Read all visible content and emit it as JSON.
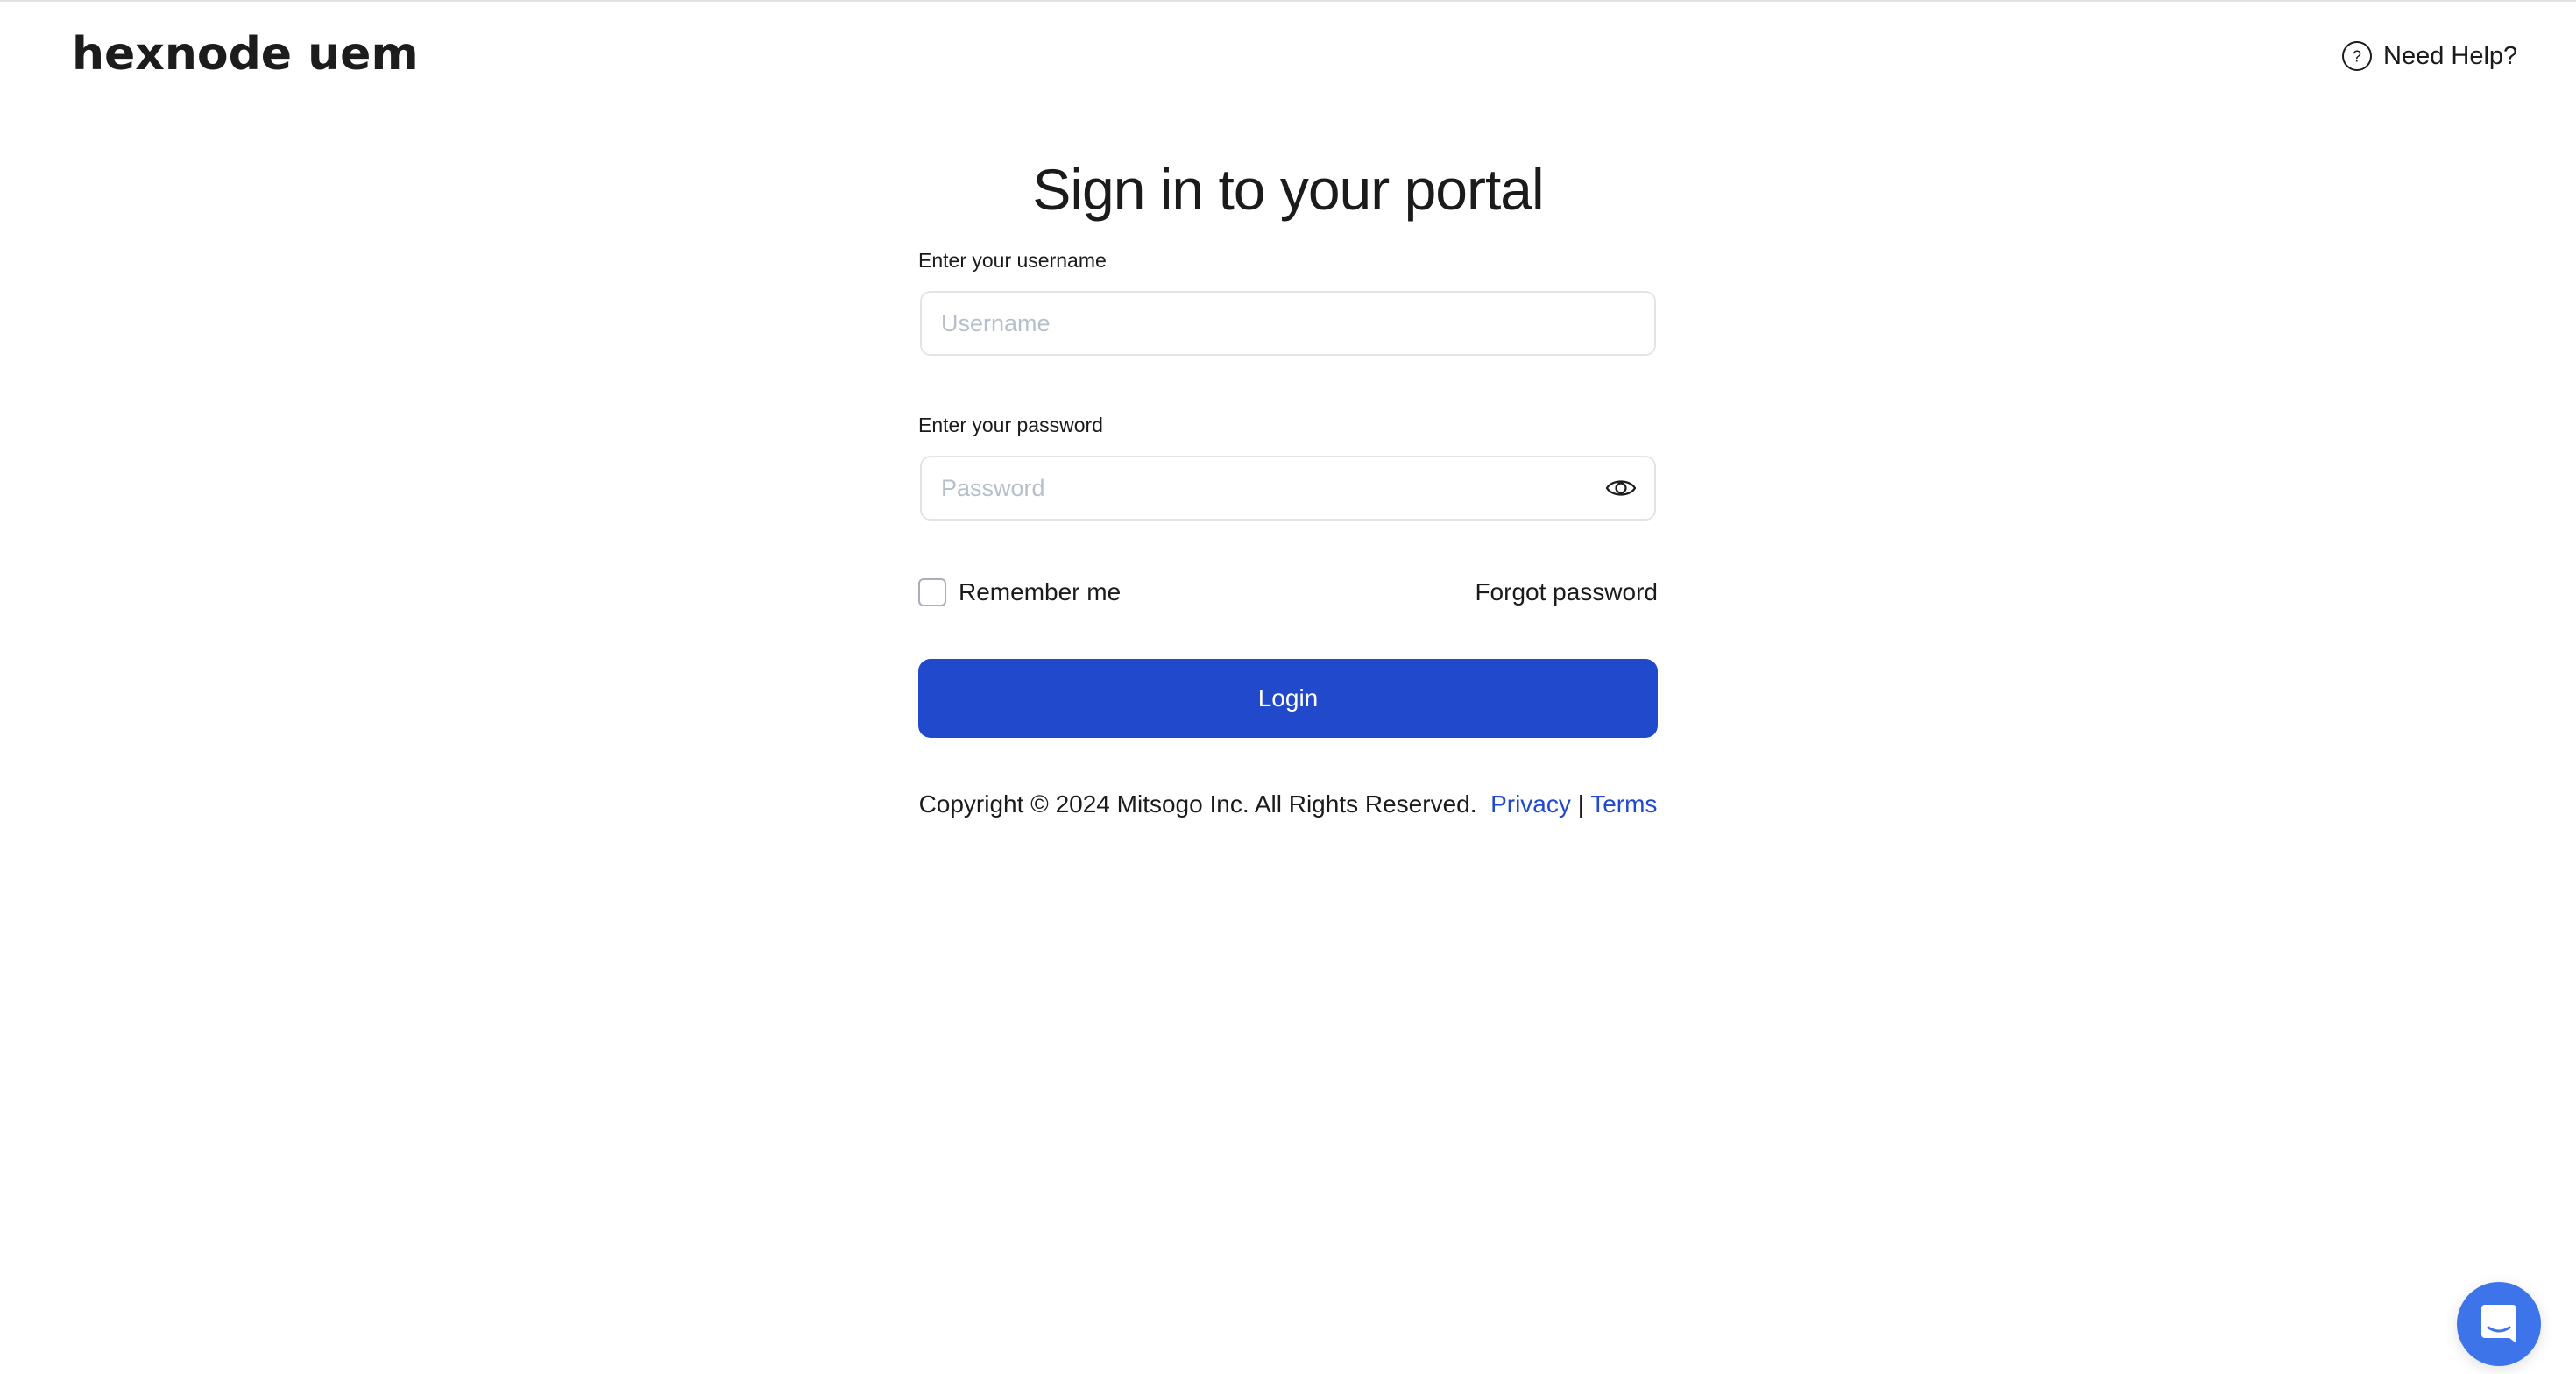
{
  "header": {
    "logo_text": "hexnode uem",
    "help_label": "Need Help?",
    "help_icon": "question-circle-icon"
  },
  "main": {
    "title": "Sign in to your portal",
    "username": {
      "label": "Enter your username",
      "placeholder": "Username",
      "value": ""
    },
    "password": {
      "label": "Enter your password",
      "placeholder": "Password",
      "value": "",
      "toggle_icon": "eye-icon"
    },
    "remember_me": {
      "label": "Remember me",
      "checked": false
    },
    "forgot_password_label": "Forgot password",
    "login_label": "Login"
  },
  "footer": {
    "copyright": "Copyright © 2024 Mitsogo Inc. All Rights Reserved.",
    "privacy_label": "Privacy",
    "separator": "|",
    "terms_label": "Terms"
  },
  "chat_widget": {
    "icon": "chat-bubble-icon"
  },
  "colors": {
    "primary": "#2149cb",
    "chat_widget": "#3d74ea",
    "placeholder": "#b7bfc9",
    "input_border": "#e1e5ea",
    "text": "#1b1b1b"
  }
}
